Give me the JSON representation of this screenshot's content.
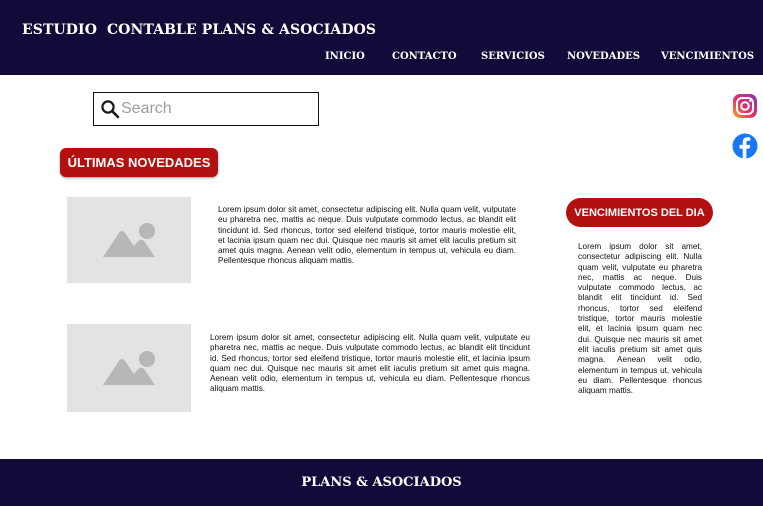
{
  "header": {
    "brand": "ESTUDIO  CONTABLE PLANS & ASOCIADOS",
    "nav": [
      "INICIO",
      "CONTACTO",
      "SERVICIOS",
      "NOVEDADES",
      "VENCIMIENTOS"
    ]
  },
  "search": {
    "placeholder": "Search"
  },
  "social": {
    "icons": [
      "instagram-icon",
      "facebook-icon"
    ]
  },
  "news": {
    "title": "ÚLTIMAS NOVEDADES",
    "items": [
      {
        "image_icon": "image-placeholder-icon",
        "text": "Lorem ipsum dolor sit amet, consectetur adipiscing elit. Nulla quam velit, vulputate eu pharetra nec, mattis ac neque. Duis vulputate commodo lectus, ac blandit elit tincidunt id. Sed rhoncus, tortor sed eleifend tristique, tortor mauris molestie elit, et lacinia ipsum quam nec dui. Quisque nec mauris sit amet elit iaculis pretium sit amet quis magna. Aenean velit odio, elementum in tempus ut, vehicula eu diam. Pellentesque rhoncus aliquam mattis."
      },
      {
        "image_icon": "image-placeholder-icon",
        "text": "Lorem ipsum dolor sit amet, consectetur adipiscing elit. Nulla quam velit, vulputate eu pharetra nec, mattis ac neque. Duis vulputate commodo lectus, ac blandit elit tincidunt id. Sed rhoncus, tortor sed eleifend tristique, tortor mauris molestie elit, et lacinia ipsum quam nec dui. Quisque nec mauris sit amet elit iaculis pretium sit amet quis magna. Aenean velit odio, elementum in tempus ut, vehicula eu diam. Pellentesque rhoncus aliquam mattis."
      }
    ]
  },
  "vencimientos": {
    "title": "VENCIMIENTOS DEL DIA",
    "text": "Lorem ipsum dolor sit amet, consectetur adipiscing elit. Nulla quam velit, vulputate eu pharetra nec, mattis ac neque. Duis vulputate commodo lectus, ac blandit elit tincidunt id. Sed rhoncus, tortor sed eleifend tristique, tortor mauris molestie elit, et lacinia ipsum quam nec dui. Quisque nec mauris sit amet elit iaculis pretium sit amet quis magna. Aenean velit odio, elementum in tempus ut, vehicula eu diam. Pellentesque rhoncus aliquam mattis."
  },
  "footer": {
    "text": "PLANS & ASOCIADOS"
  },
  "colors": {
    "navy": "#140a3a",
    "accent_red": "#b31010",
    "placeholder_gray": "#e3e3e3"
  }
}
